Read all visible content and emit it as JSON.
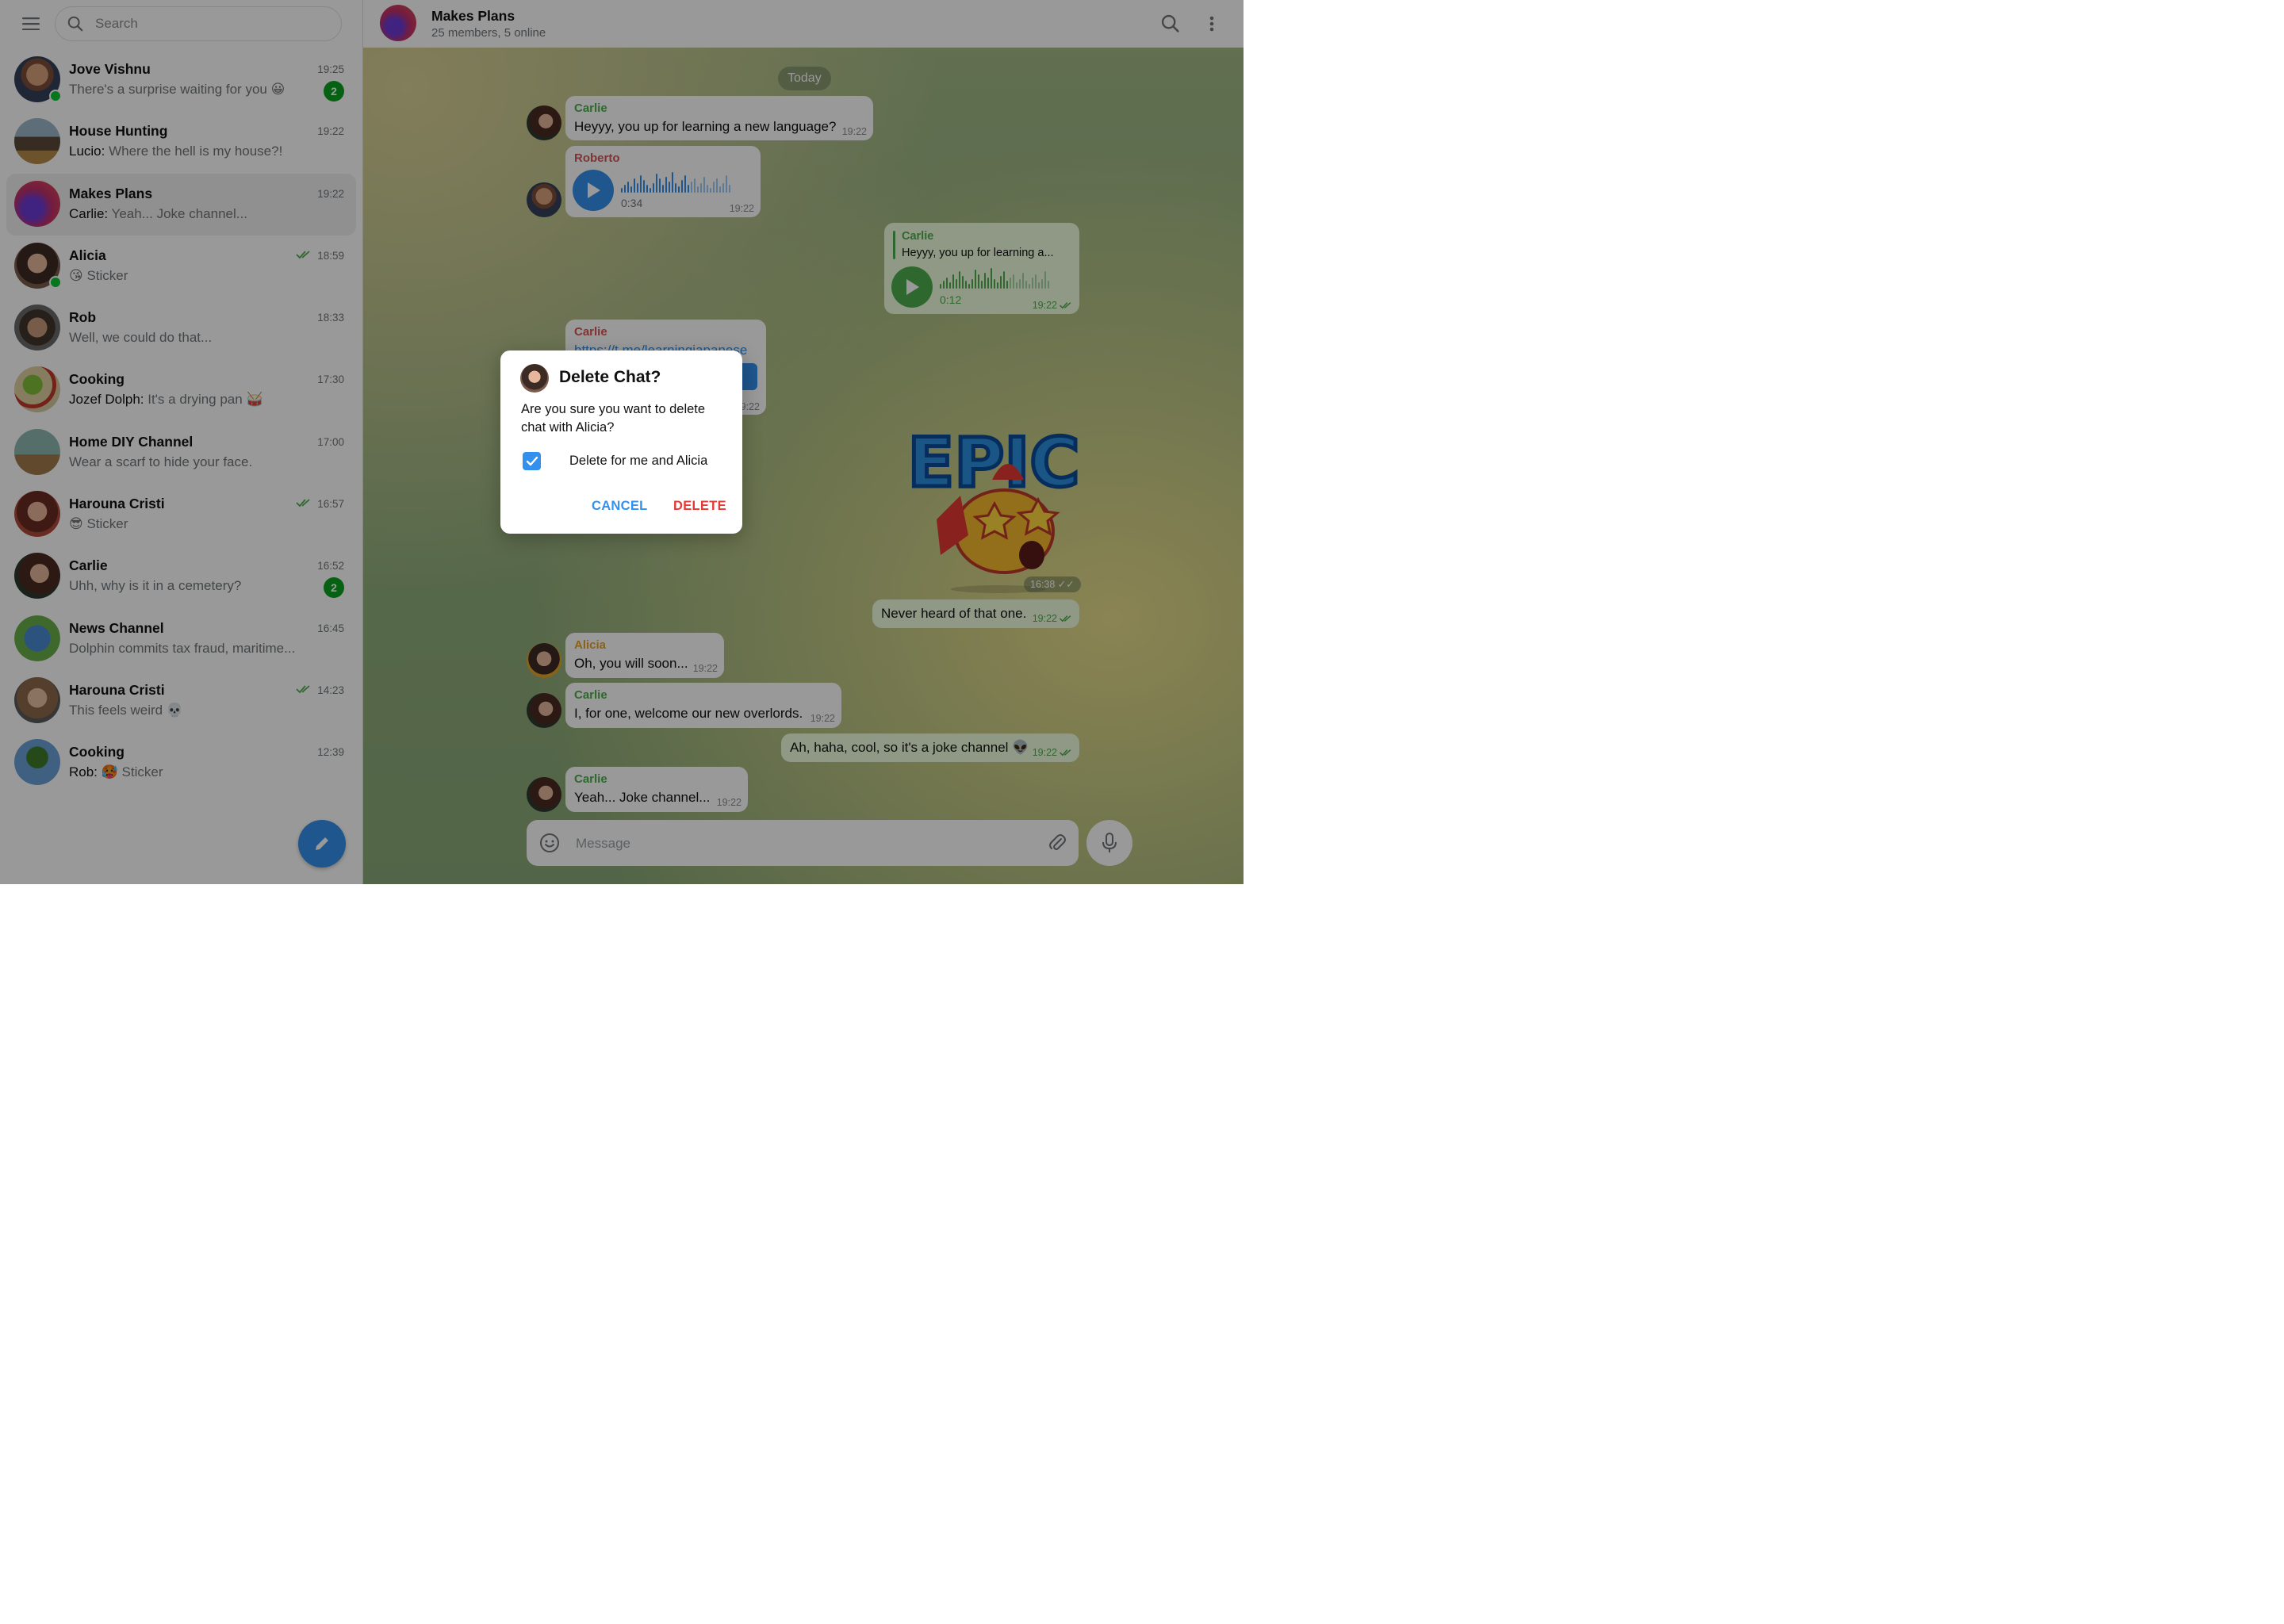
{
  "colors": {
    "accent": "#3390ec",
    "danger": "#e53935",
    "online": "#0ac630",
    "badge": "#0aa31f",
    "outgoing_bubble": "#eeffde",
    "read_ticks": "#4fae4e"
  },
  "search": {
    "placeholder": "Search"
  },
  "chats": [
    {
      "name": "Jove Vishnu",
      "sender": "",
      "preview": "There's a surprise waiting for you 😀",
      "time": "19:25",
      "badge": "2",
      "online": true,
      "read": false
    },
    {
      "name": "House Hunting",
      "sender": "Lucio: ",
      "preview": "Where the hell is my house?!",
      "time": "19:22",
      "badge": "",
      "online": false,
      "read": false
    },
    {
      "name": "Makes Plans",
      "sender": "Carlie: ",
      "preview": "Yeah... Joke channel...",
      "time": "19:22",
      "badge": "",
      "online": false,
      "read": false,
      "active": true
    },
    {
      "name": "Alicia",
      "sender": "",
      "preview": "😘 Sticker",
      "time": "18:59",
      "badge": "",
      "online": true,
      "read": true
    },
    {
      "name": "Rob",
      "sender": "",
      "preview": "Well, we could do that...",
      "time": "18:33",
      "badge": "",
      "online": false,
      "read": false
    },
    {
      "name": "Cooking",
      "sender": "Jozef Dolph: ",
      "preview": "It's a drying pan 🥁",
      "time": "17:30",
      "badge": "",
      "online": false,
      "read": false
    },
    {
      "name": "Home DIY Channel",
      "sender": "",
      "preview": "Wear a scarf to hide your face.",
      "time": "17:00",
      "badge": "",
      "online": false,
      "read": false
    },
    {
      "name": "Harouna Cristi",
      "sender": "",
      "preview": "😎 Sticker",
      "time": "16:57",
      "badge": "",
      "online": false,
      "read": true
    },
    {
      "name": "Carlie",
      "sender": "",
      "preview": "Uhh, why is it in a cemetery?",
      "time": "16:52",
      "badge": "2",
      "online": false,
      "read": false
    },
    {
      "name": "News Channel",
      "sender": "",
      "preview": "Dolphin commits tax fraud, maritime...",
      "time": "16:45",
      "badge": "",
      "online": false,
      "read": false
    },
    {
      "name": "Harouna Cristi",
      "sender": "",
      "preview": "This feels weird 💀",
      "time": "14:23",
      "badge": "",
      "online": false,
      "read": true
    },
    {
      "name": "Cooking",
      "sender": "Rob: ",
      "preview": "🥵 Sticker",
      "time": "12:39",
      "badge": "",
      "online": false,
      "read": false
    }
  ],
  "header": {
    "title": "Makes Plans",
    "subtitle": "25 members, 5 online"
  },
  "date_divider": "Today",
  "messages": {
    "m1": {
      "author": "Carlie",
      "text": "Heyyy, you up for learning a new language?",
      "time": "19:22"
    },
    "m2": {
      "author": "Roberto",
      "duration": "0:34",
      "time": "19:22"
    },
    "m3": {
      "reply_author": "Carlie",
      "reply_text": "Heyyy, you up for learning a...",
      "duration": "0:12",
      "time": "19:22"
    },
    "m4": {
      "author": "Carlie",
      "link": "https://t.me/learningjapanese",
      "time": "19:22"
    },
    "m5": {
      "sticker_text": "EPIC",
      "time": "16:38"
    },
    "m6": {
      "text": "Never heard of that one.",
      "time": "19:22"
    },
    "m7": {
      "author": "Alicia",
      "text": "Oh, you will soon...",
      "time": "19:22"
    },
    "m8": {
      "author": "Carlie",
      "text": "I, for one, welcome our new overlords.",
      "time": "19:22"
    },
    "m9": {
      "text": "Ah, haha, cool, so it's a joke channel 👽",
      "time": "19:22"
    },
    "m10": {
      "author": "Carlie",
      "text": "Yeah... Joke channel...",
      "time": "19:22"
    }
  },
  "composer": {
    "placeholder": "Message"
  },
  "dialog": {
    "title": "Delete Chat?",
    "body": "Are you sure you want to delete chat with Alicia?",
    "checkbox_label": "Delete for me and Alicia",
    "checkbox_checked": true,
    "cancel_label": "CANCEL",
    "delete_label": "DELETE"
  }
}
